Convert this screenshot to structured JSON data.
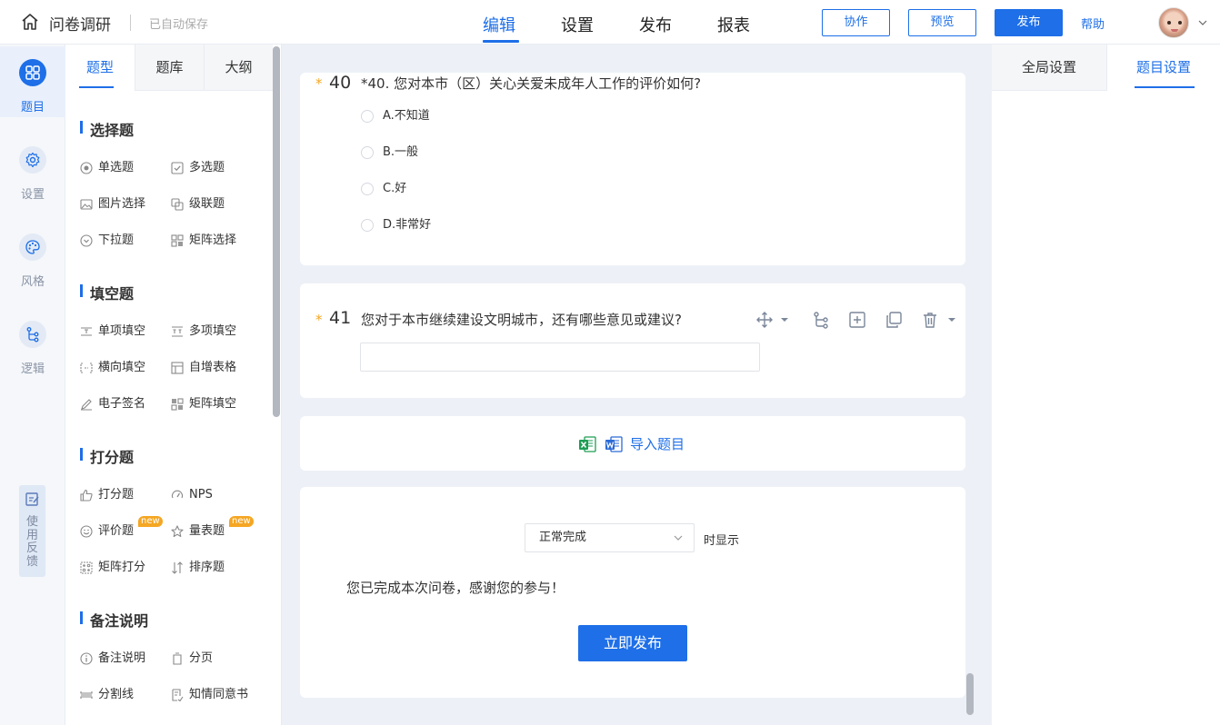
{
  "header": {
    "app_title": "问卷调研",
    "autosave": "已自动保存",
    "nav": [
      "编辑",
      "设置",
      "发布",
      "报表"
    ],
    "collaborate": "协作",
    "preview": "预览",
    "publish": "发布",
    "help": "帮助"
  },
  "rail": {
    "items": [
      {
        "label": "题目",
        "icon": "grid-icon"
      },
      {
        "label": "设置",
        "icon": "gear-icon"
      },
      {
        "label": "风格",
        "icon": "palette-icon"
      },
      {
        "label": "逻辑",
        "icon": "logic-icon"
      }
    ],
    "feedback": [
      "使",
      "用",
      "反",
      "馈"
    ]
  },
  "panel": {
    "tabs": [
      "题型",
      "题库",
      "大纲"
    ],
    "sections": [
      {
        "title": "选择题",
        "items": [
          "单选题",
          "多选题",
          "图片选择",
          "级联题",
          "下拉题",
          "矩阵选择"
        ]
      },
      {
        "title": "填空题",
        "items": [
          "单项填空",
          "多项填空",
          "横向填空",
          "自增表格",
          "电子签名",
          "矩阵填空"
        ]
      },
      {
        "title": "打分题",
        "items": [
          "打分题",
          "NPS",
          "评价题",
          "量表题",
          "矩阵打分",
          "排序题"
        ]
      },
      {
        "title": "备注说明",
        "items": [
          "备注说明",
          "分页",
          "分割线",
          "知情同意书"
        ]
      }
    ],
    "new_badge": "new"
  },
  "q40": {
    "num": "40",
    "text": "*40. 您对本市（区）关心关爱未成年人工作的评价如何?",
    "options": [
      "A.不知道",
      "B.一般",
      "C.好",
      "D.非常好"
    ]
  },
  "q41": {
    "num": "41",
    "text": "您对于本市继续建设文明城市，还有哪些意见或建议?"
  },
  "import": {
    "label": "导入题目"
  },
  "finish": {
    "select_value": "正常完成",
    "after_select": "时显示",
    "message": "您已完成本次问卷，感谢您的参与！",
    "publish_now": "立即发布"
  },
  "right": {
    "tabs": [
      "全局设置",
      "题目设置"
    ]
  },
  "colors": {
    "accent": "#1e6fe8",
    "required": "#f5a623",
    "canvas_bg": "#edf1f7"
  }
}
